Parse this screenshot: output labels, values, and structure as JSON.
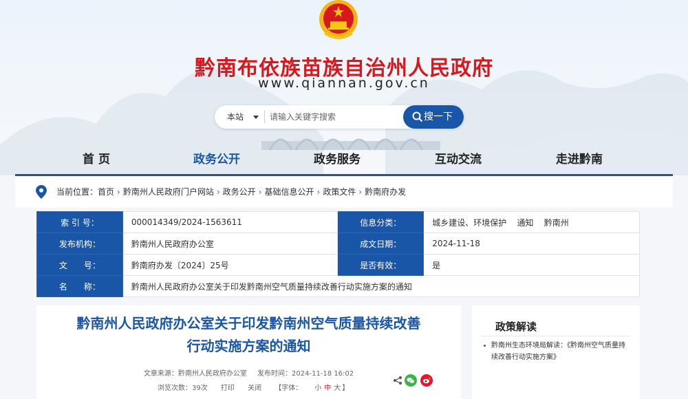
{
  "site": {
    "title": "黔南布依族苗族自治州人民政府",
    "url": "www.qiannan.gov.cn"
  },
  "search": {
    "scope": "本站",
    "placeholder": "请输入关键字搜索",
    "button": "搜一下"
  },
  "nav": [
    "首 页",
    "政务公开",
    "政务服务",
    "互动交流",
    "走进黔南"
  ],
  "breadcrumb": {
    "prefix": "当前位置：",
    "items": [
      "首页",
      "黔南州人民政府门户网站",
      "政务公开",
      "基础信息公开",
      "政策文件",
      "黔南府办发"
    ]
  },
  "info": {
    "index_label": "索 引 号：",
    "index_value": "000014349/2024-1563611",
    "category_label": "信息分类：",
    "category_value": "城乡建设、环境保护    通知    黔南州",
    "issuer_label": "发布机构：",
    "issuer_value": "黔南州人民政府办公室",
    "date_label": "成文日期：",
    "date_value": "2024-11-18",
    "docno_label": "文　　号：",
    "docno_value": "黔南府办发〔2024〕25号",
    "valid_label": "是否有效：",
    "valid_value": "是",
    "name_label": "名　　称：",
    "name_value": "黔南州人民政府办公室关于印发黔南州空气质量持续改善行动实施方案的通知"
  },
  "article": {
    "title_line1": "黔南州人民政府办公室关于印发黔南州空气质量持续改善",
    "title_line2": "行动实施方案的通知",
    "source": "文章来源：黔南州人民政府办公室",
    "time": "发布时间：2024-11-18 16:02",
    "views": "浏览次数：39次",
    "print": "打印",
    "close": "关闭",
    "font_open": "【字体：",
    "font_small": "小",
    "font_mid": "中",
    "font_large": "大",
    "font_close": "】"
  },
  "sidebar": {
    "title": "政策解读",
    "link": "黔南州生态环境局解读：《黔南州空气质量持续改善行动实施方案》"
  },
  "colors": {
    "brand_red": "#d7191e",
    "brand_blue": "#1a56a8"
  }
}
